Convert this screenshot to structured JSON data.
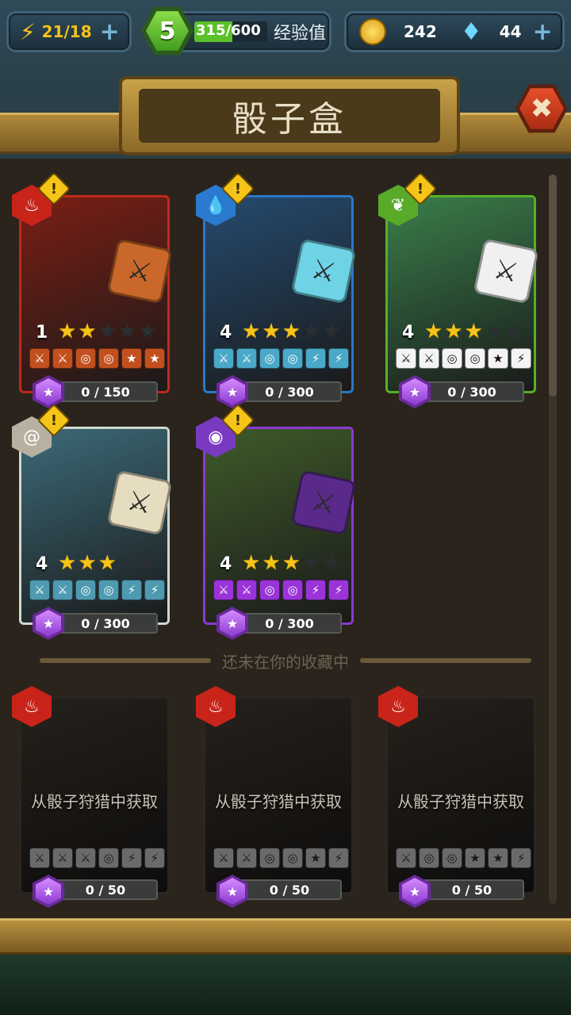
{
  "topbar": {
    "energy": "21/18",
    "level": "5",
    "xp": "315/600",
    "xp_label": "经验值",
    "coins": "242",
    "gems": "44",
    "plus": "+"
  },
  "title": "骰子盒",
  "close_glyph": "✖",
  "collected_cards": [
    {
      "element": "fire",
      "level": "1",
      "stars": 2,
      "progress": "0 / 150",
      "border": "#c0281c",
      "bg": "#7a1e14",
      "dice_color": "#c9682a",
      "face_bg": "#c2501e",
      "faces": [
        "⚔",
        "⚔",
        "◎",
        "◎",
        "★",
        "★"
      ]
    },
    {
      "element": "water",
      "level": "4",
      "stars": 3,
      "progress": "0 / 300",
      "border": "#2a78c8",
      "bg": "#254a6e",
      "dice_color": "#6fd3e6",
      "face_bg": "#4aa8c8",
      "faces": [
        "⚔",
        "⚔",
        "◎",
        "◎",
        "⚡",
        "⚡"
      ]
    },
    {
      "element": "nature",
      "level": "4",
      "stars": 3,
      "progress": "0 / 300",
      "border": "#56b02a",
      "bg": "#3a7e4a",
      "dice_color": "#f0f0f0",
      "face_bg": "#f4f4f4",
      "faces": [
        "⚔",
        "⚔",
        "◎",
        "◎",
        "★",
        "⚡"
      ]
    },
    {
      "element": "wind",
      "level": "4",
      "stars": 3,
      "progress": "0 / 300",
      "border": "#cfd8d0",
      "bg": "#3c6a78",
      "dice_color": "#e6dcc0",
      "face_bg": "#4e9ab0",
      "faces": [
        "⚔",
        "⚔",
        "◎",
        "◎",
        "⚡",
        "⚡"
      ]
    },
    {
      "element": "arcane",
      "level": "4",
      "stars": 3,
      "progress": "0 / 300",
      "border": "#8a3ad0",
      "bg": "#3e5a2a",
      "dice_color": "#5a2a8a",
      "face_bg": "#9a34d8",
      "faces": [
        "⚔",
        "⚔",
        "◎",
        "◎",
        "⚡",
        "⚡"
      ]
    }
  ],
  "divider_text": "还未在你的收藏中",
  "locked_cards": [
    {
      "element": "fire",
      "lock_text": "从骰子狩猎中获取",
      "progress": "0 / 50",
      "faces": [
        "⚔",
        "⚔",
        "⚔",
        "◎",
        "⚡",
        "⚡"
      ]
    },
    {
      "element": "fire",
      "lock_text": "从骰子狩猎中获取",
      "progress": "0 / 50",
      "faces": [
        "⚔",
        "⚔",
        "◎",
        "◎",
        "★",
        "⚡"
      ]
    },
    {
      "element": "fire",
      "lock_text": "从骰子狩猎中获取",
      "progress": "0 / 50",
      "faces": [
        "⚔",
        "◎",
        "◎",
        "★",
        "★",
        "⚡"
      ]
    }
  ],
  "warning_glyph": "!",
  "colors": {
    "accent_green": "#5cc02a",
    "gold": "#f5c418",
    "gem_purple": "#b25cf0"
  }
}
